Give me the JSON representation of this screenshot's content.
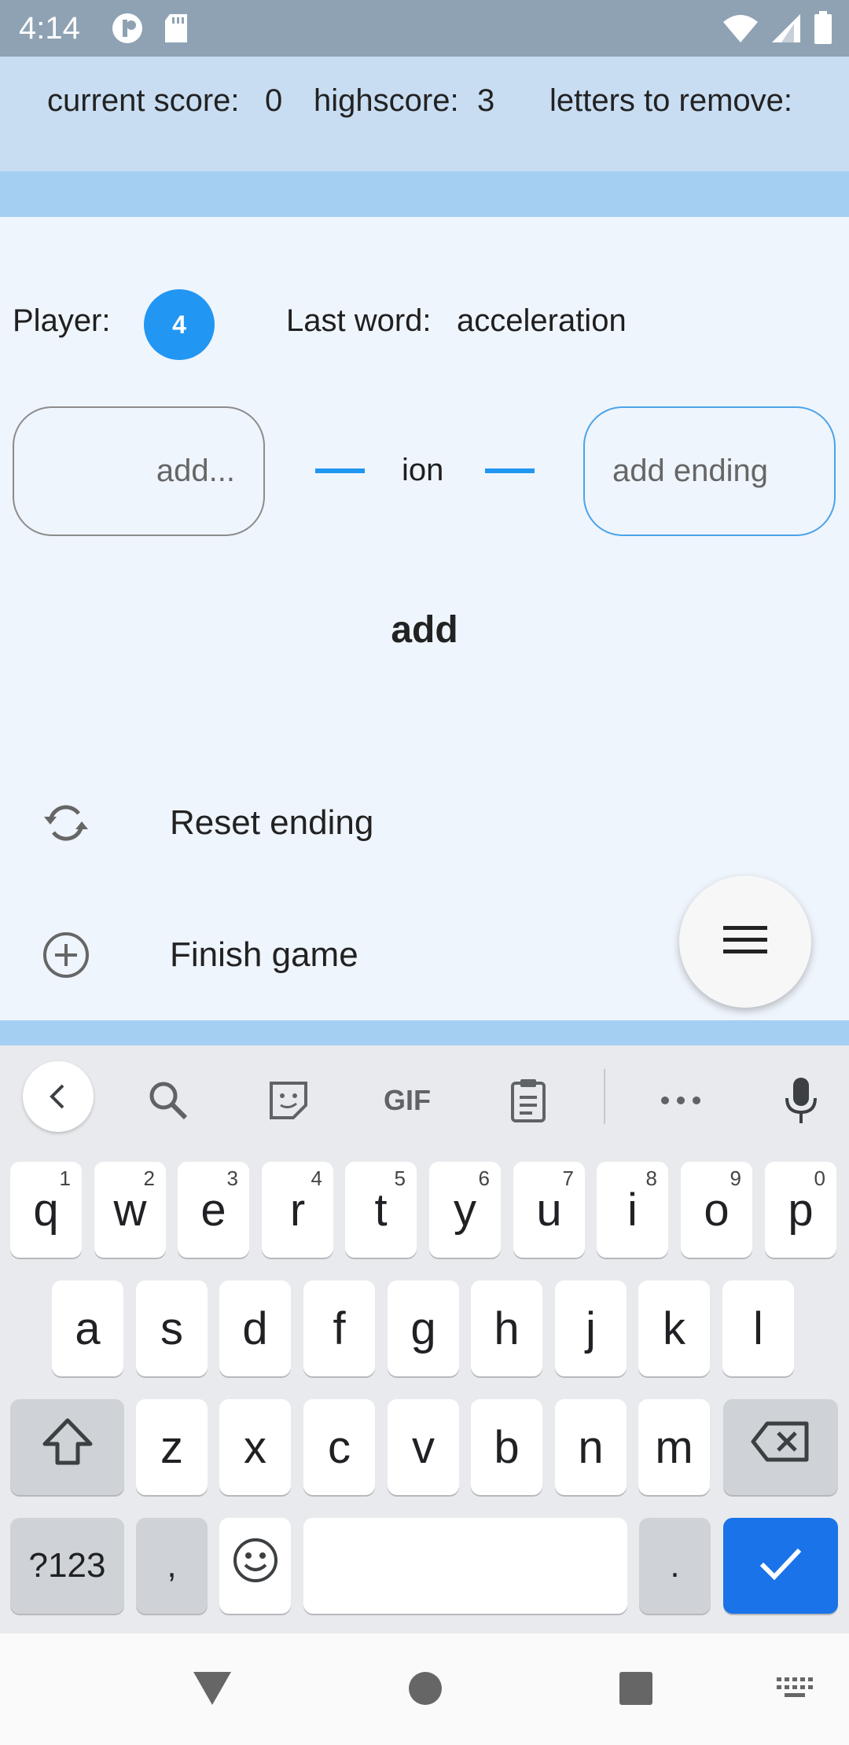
{
  "status_bar": {
    "time": "4:14",
    "left_icons": [
      "app-notification-icon",
      "sd-card-icon"
    ],
    "right_icons": [
      "wifi-icon",
      "signal-icon",
      "battery-icon"
    ]
  },
  "score_bar": {
    "current_score_label": "current score:",
    "current_score_value": "0",
    "highscore_label": "highscore:",
    "highscore_value": "3",
    "letters_label": "letters to remove:"
  },
  "game": {
    "player_label": "Player:",
    "player_number": "4",
    "last_word_label": "Last word:",
    "last_word_value": "acceleration",
    "prefix_input": {
      "placeholder": "add...",
      "value": ""
    },
    "suffix": "ion",
    "ending_input": {
      "placeholder": "add ending",
      "value": ""
    },
    "add_button": "add"
  },
  "menu": {
    "reset_label": "Reset ending",
    "finish_label": "Finish game"
  },
  "colors": {
    "accent": "#2196f3",
    "score_bar_bg": "#c8ddf2",
    "strip": "#a4cff3",
    "page_bg": "#eff5fc",
    "keyboard_enter": "#1a73e8"
  },
  "keyboard": {
    "toolbar": [
      "back-chevron-icon",
      "search-icon",
      "sticker-icon",
      "GIF",
      "clipboard-icon",
      "more-icon",
      "microphone-icon"
    ],
    "gif_label": "GIF",
    "row1": [
      {
        "k": "q",
        "h": "1"
      },
      {
        "k": "w",
        "h": "2"
      },
      {
        "k": "e",
        "h": "3"
      },
      {
        "k": "r",
        "h": "4"
      },
      {
        "k": "t",
        "h": "5"
      },
      {
        "k": "y",
        "h": "6"
      },
      {
        "k": "u",
        "h": "7"
      },
      {
        "k": "i",
        "h": "8"
      },
      {
        "k": "o",
        "h": "9"
      },
      {
        "k": "p",
        "h": "0"
      }
    ],
    "row2": [
      "a",
      "s",
      "d",
      "f",
      "g",
      "h",
      "j",
      "k",
      "l"
    ],
    "row3": [
      "z",
      "x",
      "c",
      "v",
      "b",
      "n",
      "m"
    ],
    "symbols_label": "?123",
    "comma_label": ",",
    "period_label": "."
  }
}
